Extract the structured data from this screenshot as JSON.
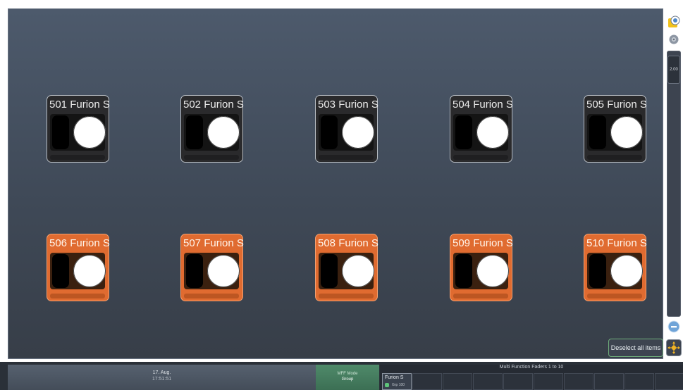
{
  "fixtures": [
    {
      "label": "501 Furion S",
      "selected": false
    },
    {
      "label": "502 Furion S",
      "selected": false
    },
    {
      "label": "503 Furion S",
      "selected": false
    },
    {
      "label": "504 Furion S",
      "selected": false
    },
    {
      "label": "505 Furion S",
      "selected": false
    },
    {
      "label": "506 Furion S",
      "selected": true
    },
    {
      "label": "507 Furion S",
      "selected": true
    },
    {
      "label": "508 Furion S",
      "selected": true
    },
    {
      "label": "509 Furion S",
      "selected": true
    },
    {
      "label": "510 Furion S",
      "selected": true
    }
  ],
  "right_panel": {
    "zoom_value": "2.00",
    "deselect_label": "Deselect all items",
    "icons": [
      "view-icon",
      "settings-icon",
      "zoom-out-icon",
      "move-icon"
    ]
  },
  "status": {
    "date": "17. Aug.",
    "time": "17:51:51"
  },
  "mff_mode": {
    "title": "MFF Mode",
    "value": "Group"
  },
  "faders": {
    "title": "Multi Function Faders 1 to 10",
    "slot1_name": "Furion S",
    "slot1_value": "Grp 100"
  },
  "colors": {
    "selected": "#e06b30",
    "unselected": "#2a2a2c",
    "accent_green": "#5fc47a"
  }
}
